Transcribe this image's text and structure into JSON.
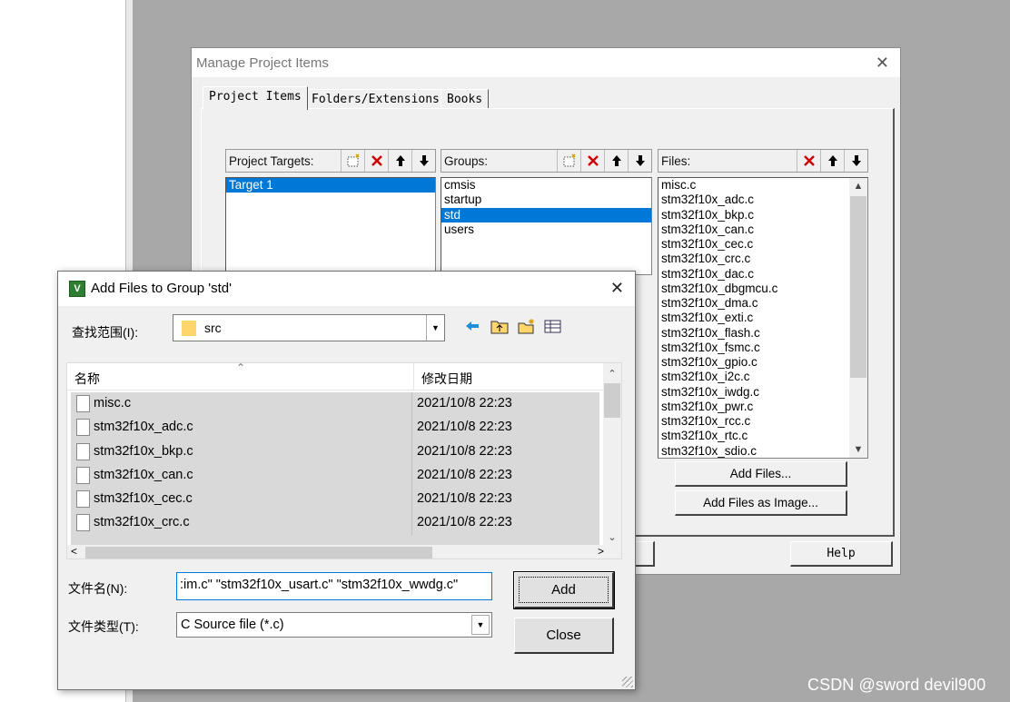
{
  "manage_window": {
    "title": "Manage Project Items",
    "tabs": [
      {
        "label": "Project Items"
      },
      {
        "label": "Folders/Extensions"
      },
      {
        "label": "Books"
      }
    ],
    "targets": {
      "header": "Project Targets:",
      "items": [
        "Target 1"
      ],
      "selected": 0
    },
    "groups": {
      "header": "Groups:",
      "items": [
        "cmsis",
        "startup",
        "std",
        "users"
      ],
      "selected": 2
    },
    "files": {
      "header": "Files:",
      "items": [
        "misc.c",
        "stm32f10x_adc.c",
        "stm32f10x_bkp.c",
        "stm32f10x_can.c",
        "stm32f10x_cec.c",
        "stm32f10x_crc.c",
        "stm32f10x_dac.c",
        "stm32f10x_dbgmcu.c",
        "stm32f10x_dma.c",
        "stm32f10x_exti.c",
        "stm32f10x_flash.c",
        "stm32f10x_fsmc.c",
        "stm32f10x_gpio.c",
        "stm32f10x_i2c.c",
        "stm32f10x_iwdg.c",
        "stm32f10x_pwr.c",
        "stm32f10x_rcc.c",
        "stm32f10x_rtc.c",
        "stm32f10x_sdio.c"
      ]
    },
    "add_files_button": "Add Files...",
    "add_files_image_button": "Add Files as Image...",
    "help_button": "Help"
  },
  "add_dialog": {
    "title": "Add Files to Group 'std'",
    "app_icon": "keil-uvision-icon",
    "look_in_label": "查找范围(I):",
    "look_in_value": "src",
    "toolbar_icons": [
      "back-arrow-icon",
      "up-folder-icon",
      "new-folder-icon",
      "view-menu-icon"
    ],
    "columns": {
      "name": "名称",
      "modified": "修改日期"
    },
    "files": [
      {
        "name": "misc.c",
        "date": "2021/10/8 22:23"
      },
      {
        "name": "stm32f10x_adc.c",
        "date": "2021/10/8 22:23"
      },
      {
        "name": "stm32f10x_bkp.c",
        "date": "2021/10/8 22:23"
      },
      {
        "name": "stm32f10x_can.c",
        "date": "2021/10/8 22:23"
      },
      {
        "name": "stm32f10x_cec.c",
        "date": "2021/10/8 22:23"
      },
      {
        "name": "stm32f10x_crc.c",
        "date": "2021/10/8 22:23"
      }
    ],
    "filename_label": "文件名(N):",
    "filename_value": ":im.c\" \"stm32f10x_usart.c\" \"stm32f10x_wwdg.c\"",
    "filetype_label": "文件类型(T):",
    "filetype_value": "C Source file (*.c)",
    "add_button": "Add",
    "close_button": "Close"
  },
  "watermark": "CSDN @sword devil900",
  "colors": {
    "selection": "#0078d7",
    "desktop": "#a8a8a8",
    "dialog_bg": "#f0f0f0"
  }
}
